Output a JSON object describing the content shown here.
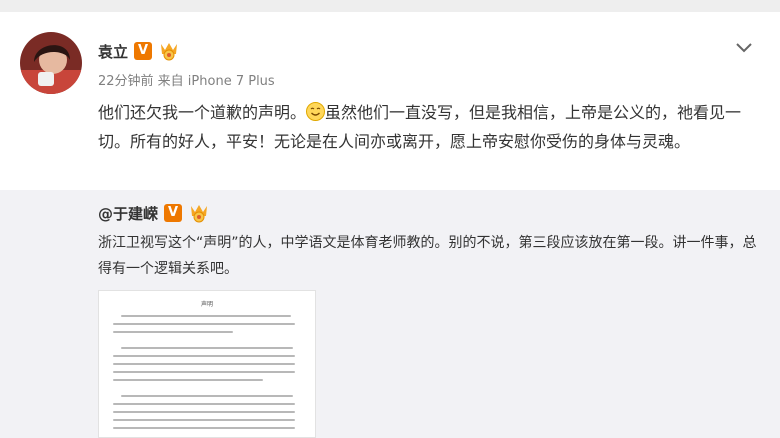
{
  "post": {
    "author": "袁立",
    "meta": "22分钟前 来自 iPhone 7 Plus",
    "text_before_emoji": "他们还欠我一个道歉的声明。",
    "text_after_emoji": "虽然他们一直没写，但是我相信，上帝是公义的，祂看见一切。所有的好人，平安！无论是在人间亦或离开，愿上帝安慰你受伤的身体与灵魂。",
    "badge": "V"
  },
  "repost": {
    "author": "@于建嵘",
    "badge": "V",
    "text": "浙江卫视写这个“声明”的人，中学语文是体育老师教的。别的不说，第三段应该放在第一段。讲一件事，总得有一个逻辑关系吧。",
    "document_title": "声明"
  },
  "icons": {
    "verified": "vip-v-icon",
    "medal": "medal-icon",
    "emoji": "smile-icon",
    "menu": "chevron-down-icon"
  },
  "colors": {
    "badge": "#ee7800",
    "repost_background": "#f2f2f5",
    "meta_text": "#808080"
  }
}
